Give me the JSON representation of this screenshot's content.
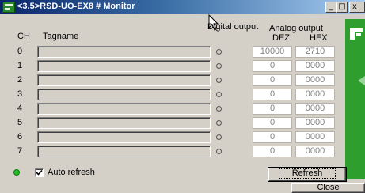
{
  "window": {
    "title": "<3.5>RSD-UO-EX8 # Monitor",
    "minimize_glyph": "_",
    "maximize_glyph": "□",
    "close_glyph": "x"
  },
  "headers": {
    "ch": "CH",
    "tagname": "Tagname",
    "digital_output": "Digital output",
    "analog_output": "Analog output",
    "dez": "DEZ",
    "hex": "HEX"
  },
  "channels": [
    {
      "ch": "0",
      "tagname": "",
      "dez": "10000",
      "hex": "2710"
    },
    {
      "ch": "1",
      "tagname": "",
      "dez": "0",
      "hex": "0000"
    },
    {
      "ch": "2",
      "tagname": "",
      "dez": "0",
      "hex": "0000"
    },
    {
      "ch": "3",
      "tagname": "",
      "dez": "0",
      "hex": "0000"
    },
    {
      "ch": "4",
      "tagname": "",
      "dez": "0",
      "hex": "0000"
    },
    {
      "ch": "5",
      "tagname": "",
      "dez": "0",
      "hex": "0000"
    },
    {
      "ch": "6",
      "tagname": "",
      "dez": "0",
      "hex": "0000"
    },
    {
      "ch": "7",
      "tagname": "",
      "dez": "0",
      "hex": "0000"
    }
  ],
  "footer": {
    "auto_refresh_label": "Auto refresh",
    "auto_refresh_checked": true,
    "refresh_label": "Refresh",
    "close_label": "Close"
  },
  "colors": {
    "status_led": "#28c028",
    "side_panel": "#2e9e2e"
  }
}
